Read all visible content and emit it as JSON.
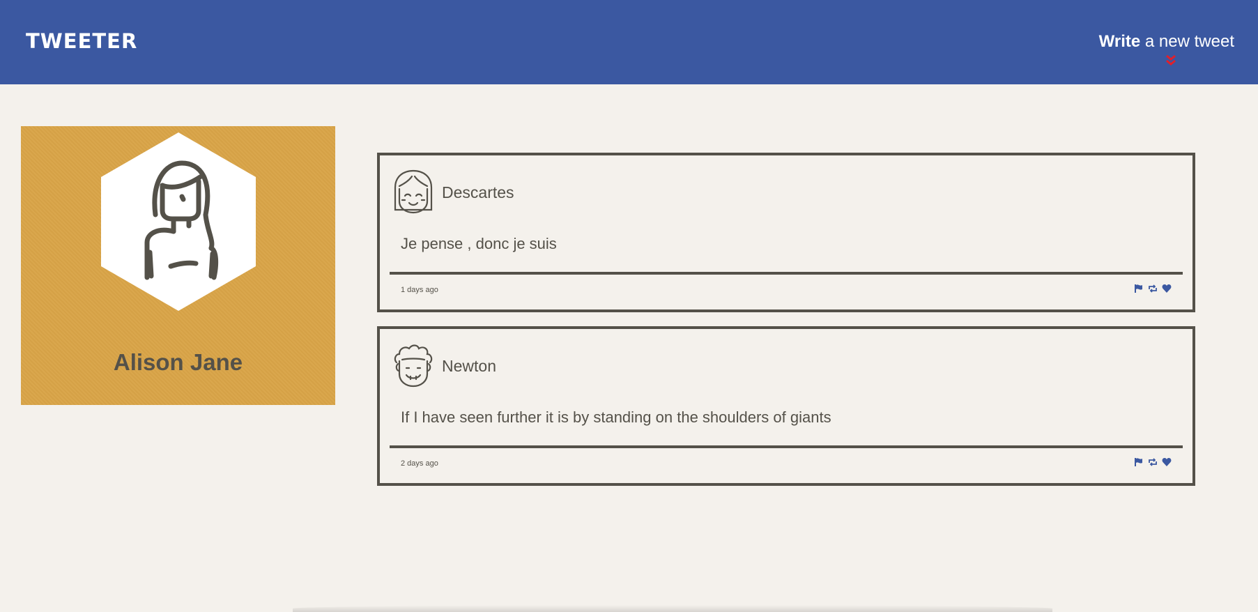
{
  "header": {
    "brand": "TWEETER",
    "compose_strong": "Write",
    "compose_rest": " a new tweet",
    "chevron_icon": "double-chevron-down-icon",
    "bg_color": "#3b58a1",
    "accent_color": "#e0202c"
  },
  "profile": {
    "name": "Alison Jane",
    "avatar_icon": "woman-avatar-icon",
    "bg_color": "#d9a447"
  },
  "tweets": [
    {
      "author": "Descartes",
      "avatar_icon": "girl-avatar-icon",
      "text": "Je pense , donc je suis",
      "time": "1 days ago",
      "actions": [
        "flag-icon",
        "retweet-icon",
        "heart-icon"
      ]
    },
    {
      "author": "Newton",
      "avatar_icon": "curly-hair-avatar-icon",
      "text": "If I have seen further it is by standing on the shoulders of giants",
      "time": "2 days ago",
      "actions": [
        "flag-icon",
        "retweet-icon",
        "heart-icon"
      ]
    }
  ]
}
